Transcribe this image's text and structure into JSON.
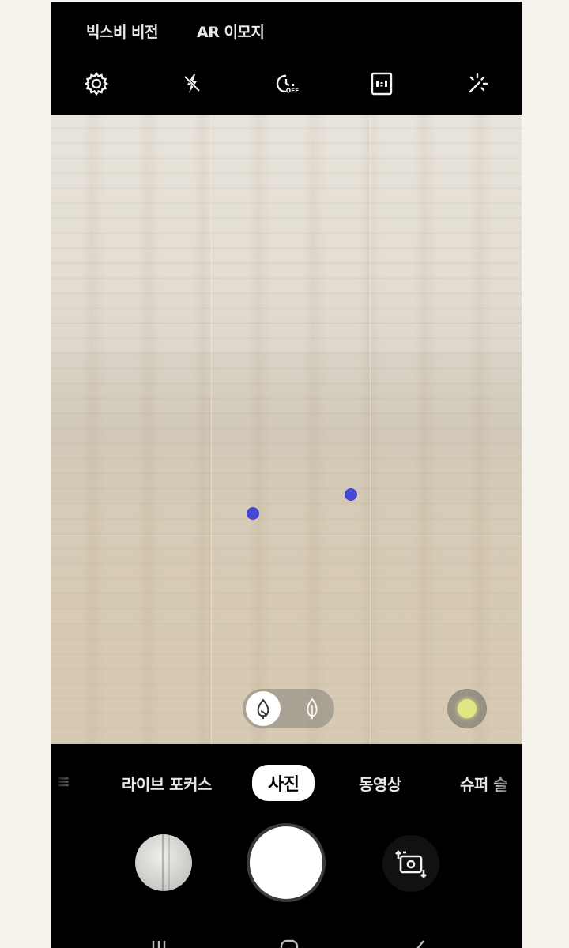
{
  "top_links": {
    "bixby_vision": "빅스비 비전",
    "ar_emoji": "AR 이모지"
  },
  "toolbar": {
    "icons": [
      "gear-icon",
      "flash-off-icon",
      "timer-off-icon",
      "aspect-ratio-icon",
      "sparkle-effects-icon"
    ],
    "timer_badge": "OFF"
  },
  "viewfinder": {
    "scene_toggle": {
      "options": [
        "focus-leaf-icon",
        "leaf-outline-icon"
      ],
      "selected": 0
    },
    "lens_indicator_color": "#dfe684",
    "af_point_color": "#4747d6"
  },
  "modes": {
    "items": [
      "라이브 포커스",
      "사진",
      "동영상",
      "슈퍼 슬"
    ],
    "selected": "사진"
  },
  "controls": {
    "gallery": "gallery-thumbnail",
    "shutter": "shutter-button",
    "switch": "switch-camera-icon"
  },
  "nav": [
    "recent-apps-icon",
    "home-icon",
    "back-icon"
  ]
}
